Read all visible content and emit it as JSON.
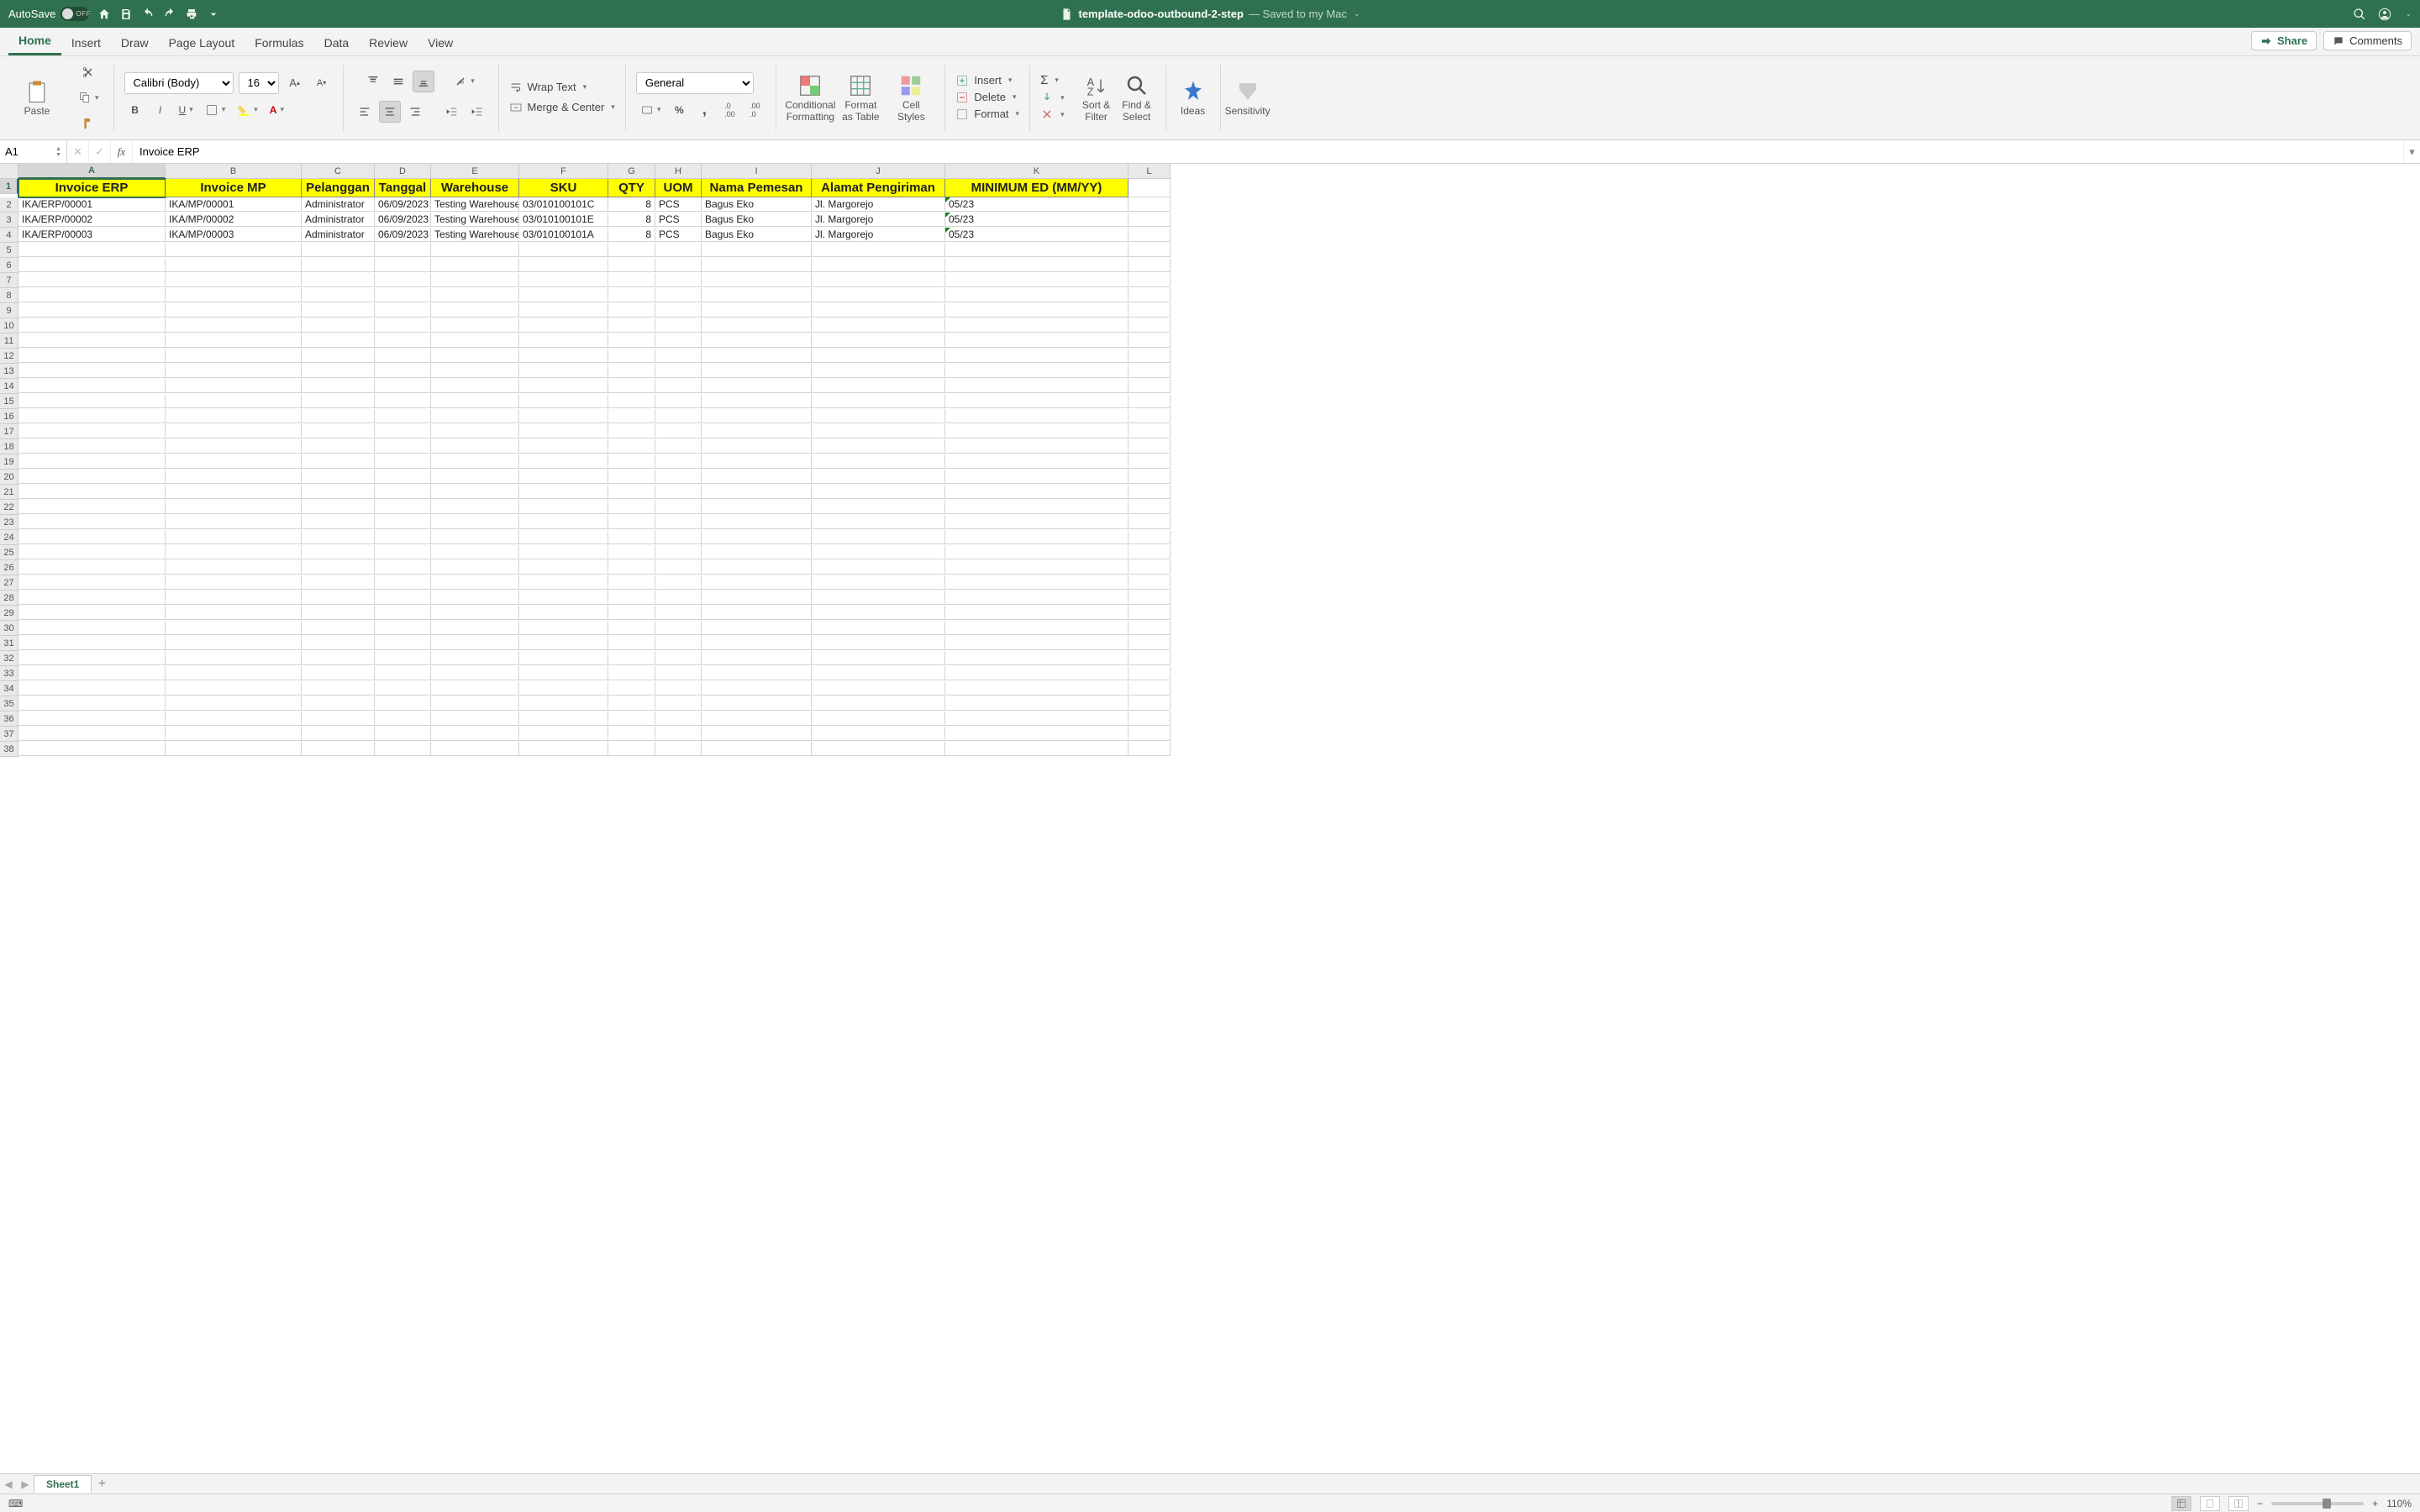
{
  "titlebar": {
    "autosave_label": "AutoSave",
    "autosave_state": "OFF",
    "filename": "template-odoo-outbound-2-step",
    "saved_text": "— Saved to my Mac"
  },
  "tabs": [
    "Home",
    "Insert",
    "Draw",
    "Page Layout",
    "Formulas",
    "Data",
    "Review",
    "View"
  ],
  "active_tab": "Home",
  "share_label": "Share",
  "comments_label": "Comments",
  "ribbon": {
    "paste": "Paste",
    "font_name": "Calibri (Body)",
    "font_size": "16",
    "wrap_text": "Wrap Text",
    "merge_center": "Merge & Center",
    "number_format": "General",
    "cond_fmt": "Conditional\nFormatting",
    "fmt_table": "Format\nas Table",
    "cell_styles": "Cell\nStyles",
    "insert": "Insert",
    "delete": "Delete",
    "format": "Format",
    "sort_filter": "Sort &\nFilter",
    "find_select": "Find &\nSelect",
    "ideas": "Ideas",
    "sensitivity": "Sensitivity"
  },
  "namebox": "A1",
  "formula": "Invoice ERP",
  "columns": [
    "A",
    "B",
    "C",
    "D",
    "E",
    "F",
    "G",
    "H",
    "I",
    "J",
    "K",
    "L"
  ],
  "headers": [
    "Invoice ERP",
    "Invoice MP",
    "Pelanggan",
    "Tanggal",
    "Warehouse",
    "SKU",
    "QTY",
    "UOM",
    "Nama Pemesan",
    "Alamat Pengiriman",
    "MINIMUM ED (MM/YY)"
  ],
  "rows": [
    {
      "a": "IKA/ERP/00001",
      "b": "IKA/MP/00001",
      "c": "Administrator",
      "d": "06/09/2023",
      "e": "Testing Warehouse",
      "f": "03/010100101C",
      "g": "8",
      "h": "PCS",
      "i": "Bagus Eko",
      "j": "Jl. Margorejo",
      "k": "05/23"
    },
    {
      "a": "IKA/ERP/00002",
      "b": "IKA/MP/00002",
      "c": "Administrator",
      "d": "06/09/2023",
      "e": "Testing Warehouse",
      "f": "03/010100101E",
      "g": "8",
      "h": "PCS",
      "i": "Bagus Eko",
      "j": "Jl. Margorejo",
      "k": "05/23"
    },
    {
      "a": "IKA/ERP/00003",
      "b": "IKA/MP/00003",
      "c": "Administrator",
      "d": "06/09/2023",
      "e": "Testing Warehouse",
      "f": "03/010100101A",
      "g": "8",
      "h": "PCS",
      "i": "Bagus Eko",
      "j": "Jl. Margorejo",
      "k": "05/23"
    }
  ],
  "sheet_name": "Sheet1",
  "zoom": "110%"
}
